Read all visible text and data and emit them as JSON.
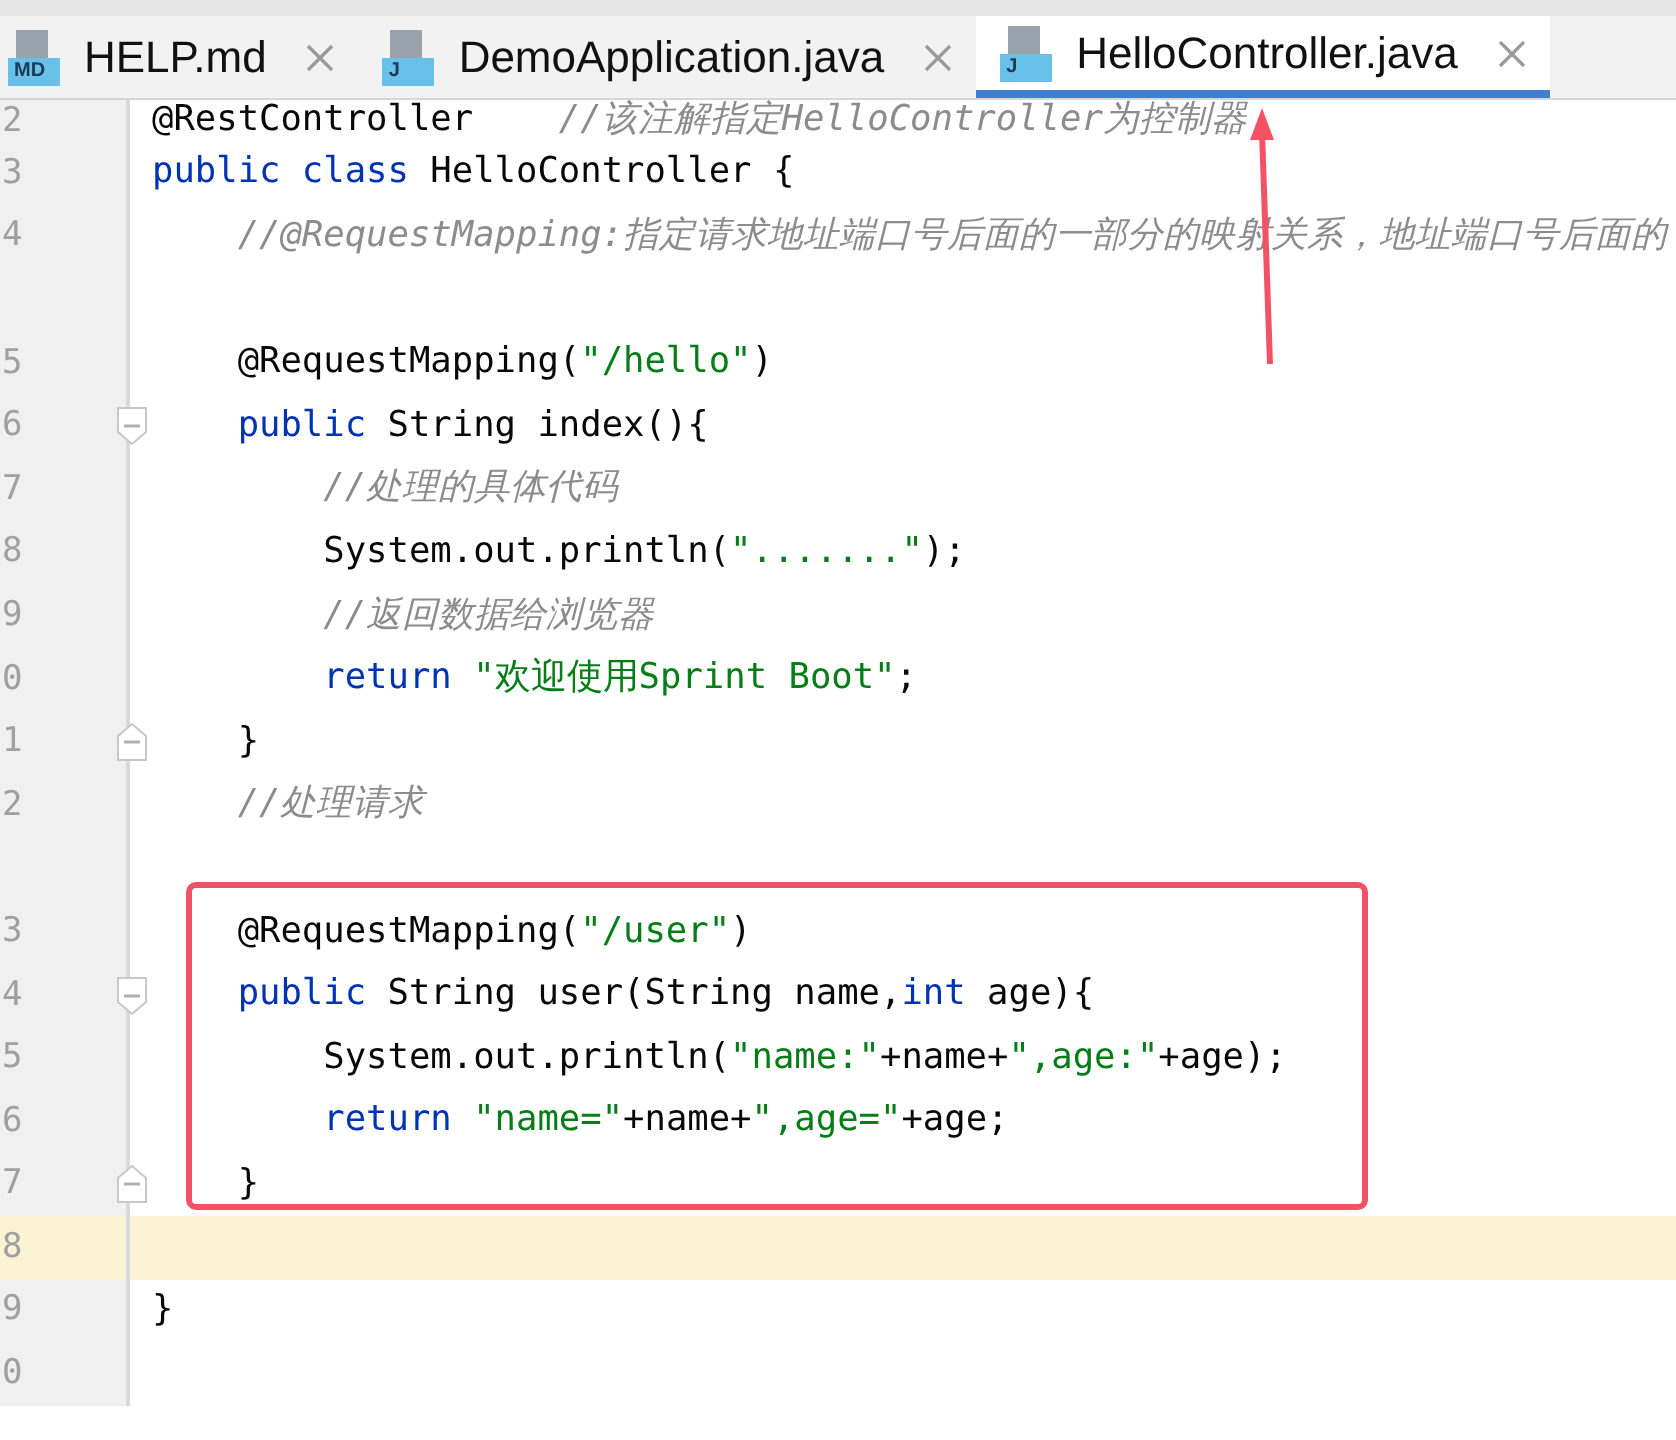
{
  "tabs": [
    {
      "label": "HELP.md",
      "icon_label": "MD",
      "selected": false
    },
    {
      "label": "DemoApplication.java",
      "icon_label": "J",
      "selected": false
    },
    {
      "label": "HelloController.java",
      "icon_label": "J",
      "selected": true
    }
  ],
  "lines": [
    {
      "number": "2",
      "kind": "code",
      "current": false,
      "segments": [
        {
          "kind": "annotation",
          "text": "@RestController    "
        },
        {
          "kind": "comment",
          "text": "//该注解指定HelloController为控制器"
        }
      ]
    },
    {
      "number": "3",
      "kind": "code",
      "current": false,
      "segments": [
        {
          "kind": "keyword",
          "text": "public class "
        },
        {
          "kind": "plain",
          "text": "HelloController {"
        }
      ]
    },
    {
      "number": "4",
      "kind": "code",
      "current": false,
      "segments": [
        {
          "kind": "comment",
          "text": "    //@RequestMapping:指定请求地址端口号后面的一部分的映射关系，地址端口号后面的"
        }
      ]
    },
    {
      "kind": "code",
      "current": false
    },
    {
      "number": "5",
      "kind": "code",
      "current": false,
      "segments": [
        {
          "kind": "plain",
          "text": "    @RequestMapping("
        },
        {
          "kind": "string",
          "text": "\"/hello\""
        },
        {
          "kind": "plain",
          "text": ")"
        }
      ]
    },
    {
      "number": "6",
      "kind": "fold_start",
      "current": false,
      "segments": [
        {
          "kind": "keyword",
          "text": "    public "
        },
        {
          "kind": "plain",
          "text": "String index(){"
        }
      ]
    },
    {
      "number": "7",
      "kind": "code",
      "current": false,
      "segments": [
        {
          "kind": "comment",
          "text": "        //处理的具体代码"
        }
      ]
    },
    {
      "number": "8",
      "kind": "code",
      "current": false,
      "segments": [
        {
          "kind": "plain",
          "text": "        System.out.println("
        },
        {
          "kind": "string",
          "text": "\".......\""
        },
        {
          "kind": "plain",
          "text": ");"
        }
      ]
    },
    {
      "number": "9",
      "kind": "code",
      "current": false,
      "segments": [
        {
          "kind": "comment",
          "text": "        //返回数据给浏览器"
        }
      ]
    },
    {
      "number": "0",
      "kind": "code",
      "current": false,
      "segments": [
        {
          "kind": "keyword",
          "text": "        return "
        },
        {
          "kind": "string",
          "text": "\"欢迎使用Sprint Boot\""
        },
        {
          "kind": "plain",
          "text": ";"
        }
      ]
    },
    {
      "number": "1",
      "kind": "fold_end",
      "current": false,
      "segments": [
        {
          "kind": "plain",
          "text": "    }"
        }
      ]
    },
    {
      "number": "2",
      "kind": "code",
      "current": false,
      "segments": [
        {
          "kind": "comment",
          "text": "    //处理请求"
        }
      ]
    },
    {
      "kind": "code",
      "current": false
    },
    {
      "number": "3",
      "kind": "code",
      "current": false,
      "segments": [
        {
          "kind": "plain",
          "text": "    @RequestMapping("
        },
        {
          "kind": "string",
          "text": "\"/user\""
        },
        {
          "kind": "plain",
          "text": ")"
        }
      ]
    },
    {
      "number": "4",
      "kind": "fold_start",
      "current": false,
      "segments": [
        {
          "kind": "keyword",
          "text": "    public "
        },
        {
          "kind": "plain",
          "text": "String user(String name,"
        },
        {
          "kind": "keyword",
          "text": "int "
        },
        {
          "kind": "plain",
          "text": "age){"
        }
      ]
    },
    {
      "number": "5",
      "kind": "code",
      "current": false,
      "segments": [
        {
          "kind": "plain",
          "text": "        System.out.println("
        },
        {
          "kind": "string",
          "text": "\"name:\""
        },
        {
          "kind": "plain",
          "text": "+name+"
        },
        {
          "kind": "string",
          "text": "\",age:\""
        },
        {
          "kind": "plain",
          "text": "+age);"
        }
      ]
    },
    {
      "number": "6",
      "kind": "code",
      "current": false,
      "segments": [
        {
          "kind": "keyword",
          "text": "        return "
        },
        {
          "kind": "string",
          "text": "\"name=\""
        },
        {
          "kind": "plain",
          "text": "+name+"
        },
        {
          "kind": "string",
          "text": "\",age=\""
        },
        {
          "kind": "plain",
          "text": "+age;"
        }
      ]
    },
    {
      "number": "7",
      "kind": "fold_end",
      "current": false,
      "segments": [
        {
          "kind": "plain",
          "text": "    }"
        }
      ]
    },
    {
      "number": "8",
      "kind": "code",
      "current": true
    },
    {
      "number": "9",
      "kind": "code",
      "current": false,
      "segments": [
        {
          "kind": "plain",
          "text": "}"
        }
      ]
    },
    {
      "number": "0",
      "kind": "code",
      "current": false
    }
  ]
}
